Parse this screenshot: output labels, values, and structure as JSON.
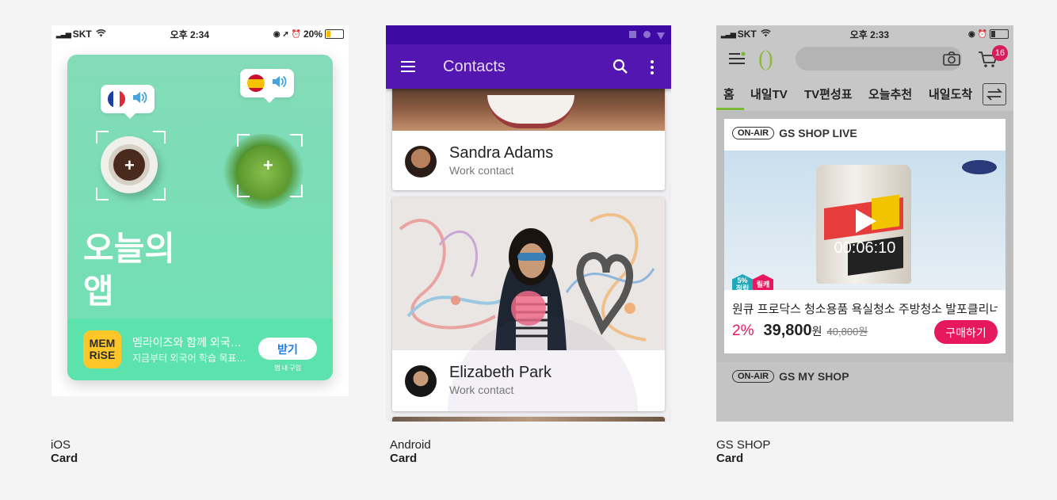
{
  "ios": {
    "status": {
      "carrier": "SKT",
      "time": "오후 2:34",
      "battery": "20%"
    },
    "card": {
      "title_line1": "오늘의",
      "title_line2": "앱",
      "app_name": "멤라이즈와 함께 외국…",
      "app_desc": "지금부터 외국어 학습 목표…",
      "icon_line1": "MEM",
      "icon_line2": "RiSE",
      "get_label": "받기",
      "in_app": "앱 내 구입"
    },
    "caption": {
      "platform": "iOS",
      "component": "Card"
    }
  },
  "android": {
    "appbar": {
      "title": "Contacts"
    },
    "contacts": [
      {
        "name": "Sandra Adams",
        "subtitle": "Work contact"
      },
      {
        "name": "Elizabeth Park",
        "subtitle": "Work contact"
      }
    ],
    "caption": {
      "platform": "Android",
      "component": "Card"
    }
  },
  "gs": {
    "status": {
      "carrier": "SKT",
      "time": "오후 2:33"
    },
    "cart_count": "16",
    "tabs": [
      "홈",
      "내일TV",
      "TV편성표",
      "오늘추천",
      "내일도착"
    ],
    "live": {
      "badge": "ON-AIR",
      "channel": "GS SHOP LIVE"
    },
    "video": {
      "timer": "00:06:10"
    },
    "badges": {
      "points": "5%\n적립",
      "tag": "릴캐"
    },
    "product": {
      "title": "원큐 프로닥스 청소용품 욕실청소 주방청소 발포클리너",
      "discount": "2%",
      "price": "39,800",
      "price_unit": "원",
      "original_price": "40,800원",
      "buy_label": "구매하기"
    },
    "next": {
      "badge": "ON-AIR",
      "channel": "GS MY SHOP"
    },
    "caption": {
      "platform": "GS SHOP",
      "component": "Card"
    }
  },
  "colors": {
    "android_primary": "#5316b0",
    "ios_card": "#84dbb9",
    "gs_accent": "#e8185f"
  }
}
